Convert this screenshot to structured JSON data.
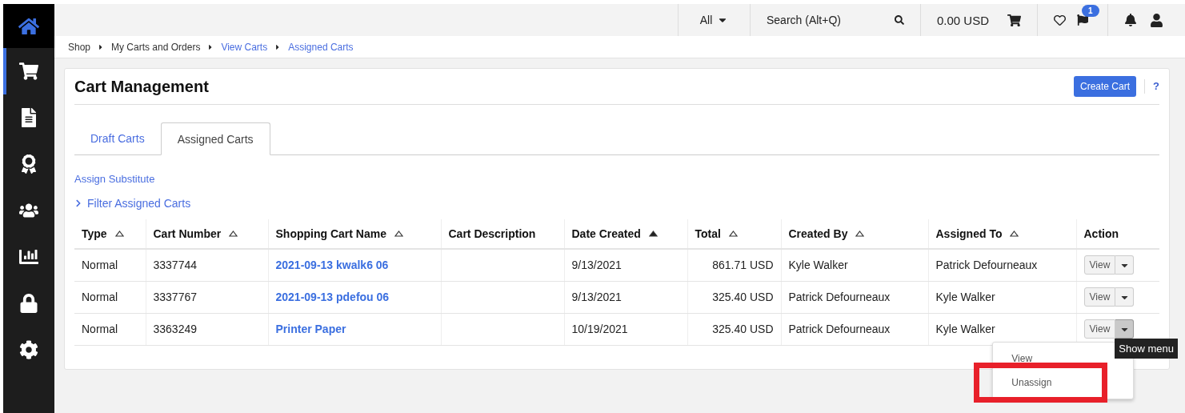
{
  "topbar": {
    "scope": "All",
    "search": {
      "placeholder": "Search (Alt+Q)"
    },
    "cart_total": "0.00 USD",
    "flag_badge": "1"
  },
  "nav": [
    {
      "selected": true
    },
    {
      "selected": false
    },
    {
      "selected": false
    },
    {
      "selected": false
    },
    {
      "selected": false
    },
    {
      "selected": false
    },
    {
      "selected": false
    }
  ],
  "breadcrumb": [
    {
      "label": "Shop",
      "kind": "text"
    },
    {
      "label": "My Carts and Orders",
      "kind": "text"
    },
    {
      "label": "View Carts",
      "kind": "link"
    },
    {
      "label": "Assigned Carts",
      "kind": "link"
    }
  ],
  "page": {
    "title": "Cart Management",
    "create_button": "Create Cart",
    "help": "?"
  },
  "tabs": [
    {
      "label": "Draft Carts",
      "selected": false
    },
    {
      "label": "Assigned Carts",
      "selected": true
    }
  ],
  "assign_link": "Assign Substitute",
  "filter": {
    "label": "Filter Assigned Carts",
    "expanded": false
  },
  "table": {
    "columns": [
      {
        "label": "Type",
        "sorted": false
      },
      {
        "label": "Cart Number",
        "sorted": false
      },
      {
        "label": "Shopping Cart Name",
        "sorted": false
      },
      {
        "label": "Cart Description"
      },
      {
        "label": "Date Created",
        "sorted": true
      },
      {
        "label": "Total",
        "sorted": false
      },
      {
        "label": "Created By",
        "sorted": false
      },
      {
        "label": "Assigned To",
        "sorted": false
      },
      {
        "label": "Action"
      }
    ],
    "rows": [
      {
        "type": "Normal",
        "cart_number": "3337744",
        "name": "2021-09-13 kwalk6 06",
        "date": "9/13/2021",
        "total": "861.71 USD",
        "created_by": "Kyle Walker",
        "assigned_to": "Patrick Defourneaux",
        "action": "View",
        "menu_open": false
      },
      {
        "type": "Normal",
        "cart_number": "3337767",
        "name": "2021-09-13 pdefou 06",
        "date": "9/13/2021",
        "total": "325.40 USD",
        "created_by": "Patrick Defourneaux",
        "assigned_to": "Kyle Walker",
        "action": "View",
        "menu_open": false
      },
      {
        "type": "Normal",
        "cart_number": "3363249",
        "name": "Printer Paper",
        "date": "10/19/2021",
        "total": "325.40 USD",
        "created_by": "Patrick Defourneaux",
        "assigned_to": "Kyle Walker",
        "action": "View",
        "menu_open": true
      }
    ]
  },
  "action_menu": {
    "items": [
      {
        "label": "View",
        "highlighted": false
      },
      {
        "label": "Unassign",
        "highlighted": true
      }
    ],
    "tooltip": "Show menu"
  }
}
